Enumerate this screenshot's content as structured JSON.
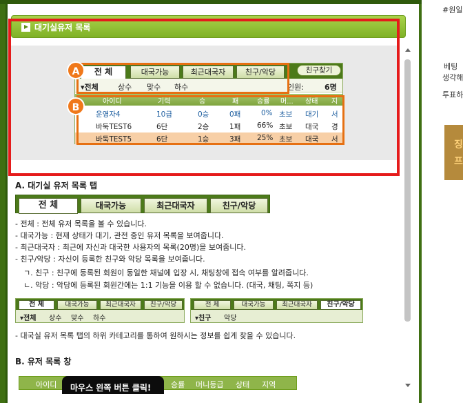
{
  "header": {
    "title": "대기실유저 목록"
  },
  "widget": {
    "tabs": [
      "전 체",
      "대국가능",
      "최근대국자",
      "친구/악당"
    ],
    "find_button": "친구찾기",
    "subtabs": [
      "▾전체",
      "상수",
      "맞수",
      "하수"
    ],
    "people_label": "인원:",
    "people_count": "6명",
    "columns": [
      "아이디",
      "기력",
      "승",
      "패",
      "승률",
      "머...",
      "상태",
      "지"
    ],
    "rows": [
      [
        "운영자4",
        "10급",
        "0승",
        "0패",
        "0%",
        "초보",
        "대기",
        "서"
      ],
      [
        "바둑TEST6",
        "6단",
        "2승",
        "1패",
        "66%",
        "초보",
        "대국",
        "경"
      ],
      [
        "바둑TEST5",
        "6단",
        "1승",
        "3패",
        "25%",
        "초보",
        "대국",
        "서"
      ]
    ],
    "marker_a": "A",
    "marker_b": "B"
  },
  "section_a": {
    "title": "A. 대기실 유저 목록 탭",
    "tabs": [
      "전 체",
      "대국가능",
      "최근대국자",
      "친구/악당"
    ],
    "lines": [
      "- 전체 : 전체 유저 목록을 볼 수 있습니다.",
      "- 대국가능 : 현재 상태가 대기, 관전 중인 유저 목록을 보여줍니다.",
      "- 최근대국자 : 최근에 자신과 대국한 사용자의 목록(20명)을 보여줍니다.",
      "- 친구/악당 : 자신이 등록한 친구와 악당 목록을 보여줍니다."
    ],
    "sub_lines": [
      "ㄱ. 친구 : 친구에 등록된 회원이 동일한 채널에 입장 시, 채팅창에 접속 여부를 알려줍니다.",
      "ㄴ. 악당 : 악당에 등록된 회원간에는 1:1 기능을 이용 할 수 없습니다. (대국, 채팅, 쪽지 등)"
    ],
    "strip_left": {
      "tabs": [
        "전 체",
        "대국가능",
        "최근대국자",
        "친구/악당"
      ],
      "subs": [
        "▾전체",
        "상수",
        "맞수",
        "하수"
      ]
    },
    "strip_right": {
      "tabs": [
        "전 체",
        "대국가능",
        "최근대국자",
        "친구/악당"
      ],
      "subs": [
        "▾친구",
        "악당"
      ]
    },
    "strip_desc": "- 대국실 유저 목록 탭의 하위 카테고리를 통하여 원하시는 정보를 쉽게 찾을 수 있습니다."
  },
  "section_b": {
    "title": "B. 유저 목록 창",
    "columns": [
      "아이디",
      "승률",
      "머니등급",
      "상태",
      "지역"
    ],
    "tooltip": "마우스 왼쪽 버튼 클릭!"
  },
  "right_strip": {
    "line1": "#원일",
    "line2": "베팅",
    "line3": "생각해",
    "line4": "투표하",
    "ad1": "징",
    "ad2": "프"
  }
}
